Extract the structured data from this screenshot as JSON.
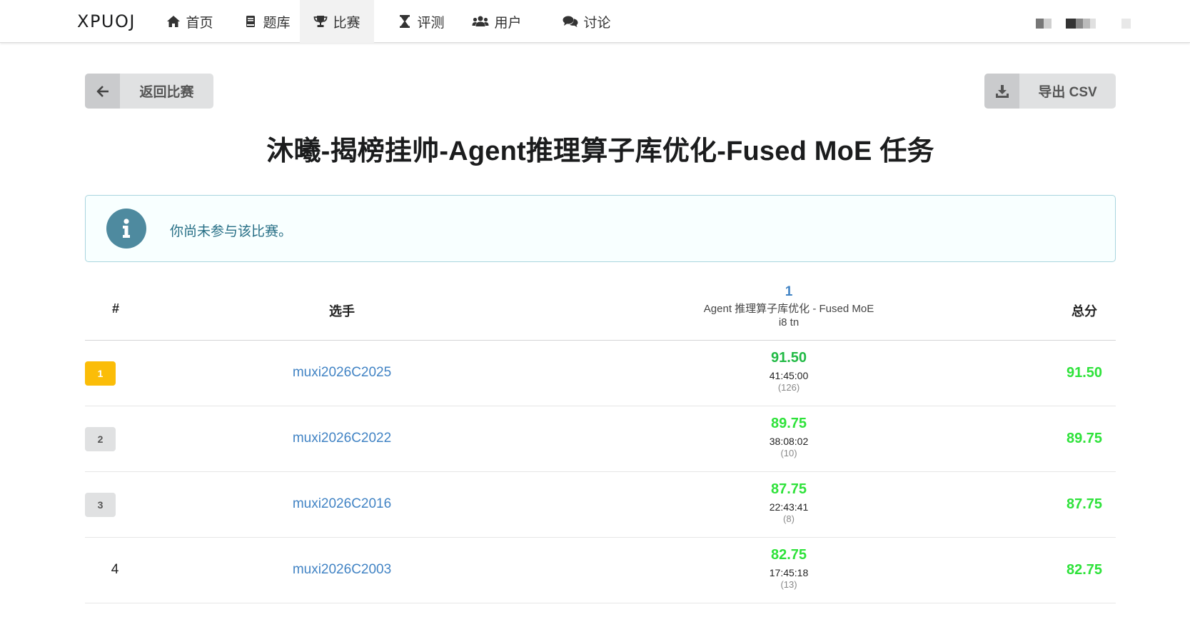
{
  "nav": {
    "brand": "XPUOJ",
    "items": [
      {
        "label": "首页",
        "icon": "home-icon"
      },
      {
        "label": "题库",
        "icon": "book-icon"
      },
      {
        "label": "比赛",
        "icon": "trophy-icon"
      },
      {
        "label": "评测",
        "icon": "hourglass-icon"
      },
      {
        "label": "用户",
        "icon": "users-icon"
      },
      {
        "label": "讨论",
        "icon": "comments-icon"
      }
    ],
    "active_index": 2
  },
  "actions": {
    "back_label": "返回比赛",
    "export_label": "导出 CSV"
  },
  "contest": {
    "title": "沐曦-揭榜挂帅-Agent推理算子库优化-Fused MoE 任务"
  },
  "notice": {
    "message": "你尚未参与该比赛。"
  },
  "table": {
    "headers": {
      "rank": "#",
      "player": "选手",
      "problem_number": "1",
      "problem_title": "Agent 推理算子库优化 - Fused MoE i8 tn",
      "total": "总分"
    },
    "rows": [
      {
        "rank": "1",
        "player": "muxi2026C2025",
        "score": "91.50",
        "time": "41:45:00",
        "submissions": "(126)",
        "total": "91.50",
        "badge": "gold"
      },
      {
        "rank": "2",
        "player": "muxi2026C2022",
        "score": "89.75",
        "time": "38:08:02",
        "submissions": "(10)",
        "total": "89.75",
        "badge": "grey"
      },
      {
        "rank": "3",
        "player": "muxi2026C2016",
        "score": "87.75",
        "time": "22:43:41",
        "submissions": "(8)",
        "total": "87.75",
        "badge": "grey"
      },
      {
        "rank": "4",
        "player": "muxi2026C2003",
        "score": "82.75",
        "time": "17:45:18",
        "submissions": "(13)",
        "total": "82.75",
        "badge": "none"
      }
    ]
  },
  "colors": {
    "score_green": "#2ee23a",
    "link_blue": "#4183c4",
    "gold": "#fbbd08",
    "info_bg": "#f8ffff",
    "info_text": "#276f86"
  }
}
